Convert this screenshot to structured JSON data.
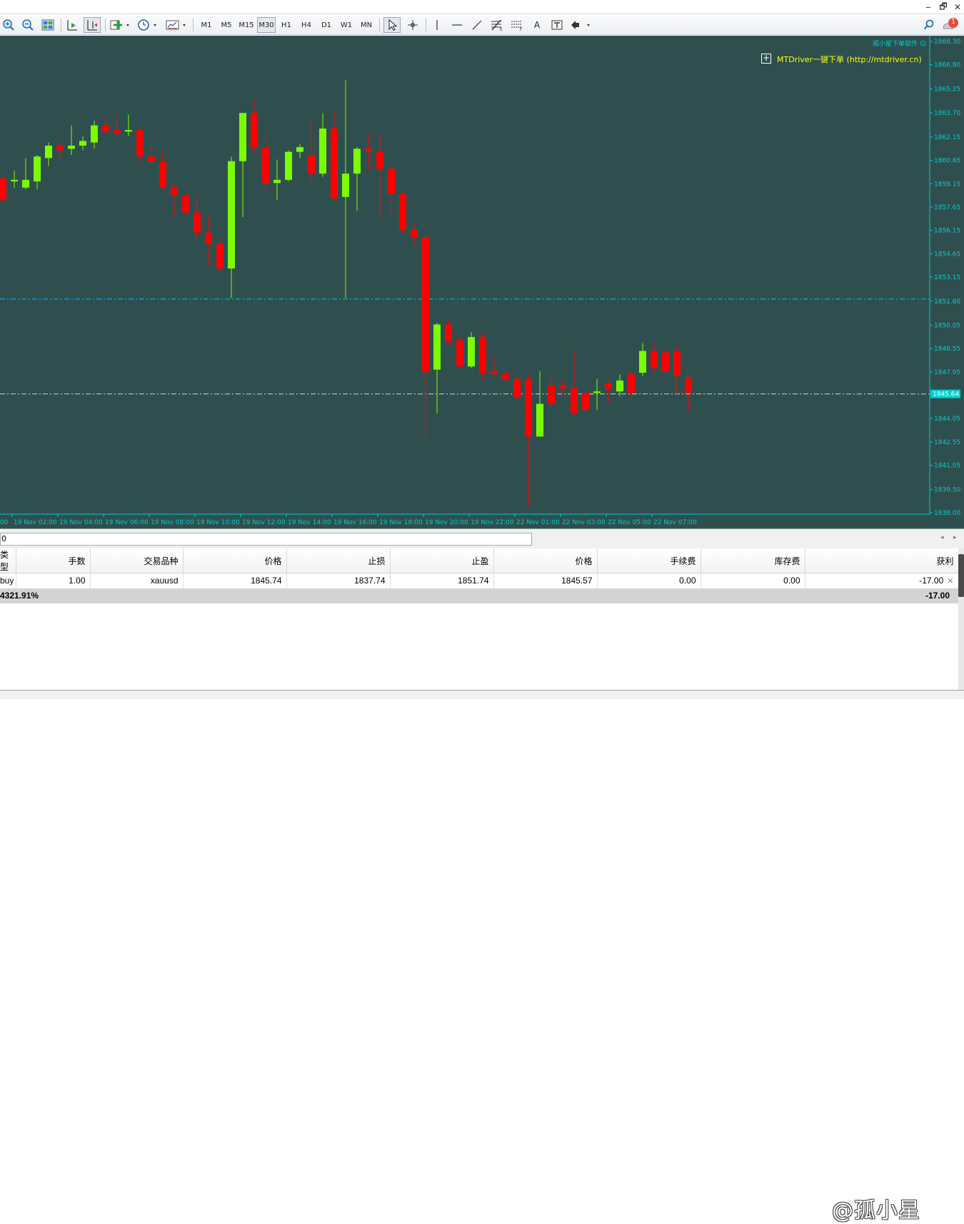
{
  "window": {
    "minimize": "‒",
    "restore": "🗗",
    "close": "✕"
  },
  "toolbar": {
    "timeframes": [
      {
        "label": "M1",
        "active": false
      },
      {
        "label": "M5",
        "active": false
      },
      {
        "label": "M15",
        "active": false
      },
      {
        "label": "M30",
        "active": true
      },
      {
        "label": "H1",
        "active": false
      },
      {
        "label": "H4",
        "active": false
      },
      {
        "label": "D1",
        "active": false
      },
      {
        "label": "W1",
        "active": false
      },
      {
        "label": "MN",
        "active": false
      }
    ],
    "icons": [
      "zoom-in-icon",
      "zoom-out-icon",
      "tile-windows-icon",
      "auto-scroll-icon",
      "chart-shift-icon",
      "indicators-icon",
      "clock-icon",
      "templates-icon",
      "cursor-icon",
      "crosshair-icon",
      "vertical-line-icon",
      "horizontal-line-icon",
      "trendline-icon",
      "fibonacci-icon",
      "channel-icon",
      "text-icon",
      "text-label-icon",
      "arrows-icon",
      "search-icon",
      "notifications-icon"
    ],
    "text_tool": "A",
    "notification_count": "1"
  },
  "chart": {
    "corner_label": "孤小星下单软件 ☺",
    "plugin_label": "MTDriver一键下单 (http://mtdriver.cn)",
    "plugin_button": "+",
    "bid_line": 1845.64,
    "bid_label": "1845.64",
    "tp_line": 1851.74,
    "colors": {
      "bg": "#2f4f4f",
      "bull": "#7cfc00",
      "bear": "#ff0000",
      "axis": "#00ced1",
      "bid_line": "#d3d3d3",
      "tp_line": "#00bfff"
    }
  },
  "chart_data": {
    "type": "candlestick",
    "symbol": "xauusd",
    "timeframe": "M30",
    "ylim": [
      1838.0,
      1868.3
    ],
    "y_ticks": [
      "1868.30",
      "1866.80",
      "1865.25",
      "1863.70",
      "1862.15",
      "1860.65",
      "1859.15",
      "1857.65",
      "1856.15",
      "1854.65",
      "1853.15",
      "1851.60",
      "1850.05",
      "1848.55",
      "1847.05",
      "1845.64",
      "1844.05",
      "1842.55",
      "1841.05",
      "1839.50",
      "1838.00"
    ],
    "x_ticks": [
      ":00",
      "19 Nov 02:00",
      "19 Nov 04:00",
      "19 Nov 06:00",
      "19 Nov 08:00",
      "19 Nov 10:00",
      "19 Nov 12:00",
      "19 Nov 14:00",
      "19 Nov 16:00",
      "19 Nov 18:00",
      "19 Nov 20:00",
      "19 Nov 22:00",
      "22 Nov 01:00",
      "22 Nov 03:00",
      "22 Nov 05:00",
      "22 Nov 07:00"
    ],
    "candles": [
      [
        1859.5,
        1859.6,
        1857.9,
        1858.1
      ],
      [
        1859.3,
        1860.0,
        1858.9,
        1859.4
      ],
      [
        1858.9,
        1860.8,
        1858.8,
        1859.4
      ],
      [
        1859.3,
        1861.0,
        1858.8,
        1860.9
      ],
      [
        1860.8,
        1861.8,
        1860.3,
        1861.6
      ],
      [
        1861.6,
        1861.8,
        1860.8,
        1861.3
      ],
      [
        1861.4,
        1862.9,
        1861.0,
        1861.6
      ],
      [
        1861.6,
        1862.2,
        1861.3,
        1861.9
      ],
      [
        1861.8,
        1863.2,
        1861.4,
        1862.9
      ],
      [
        1862.9,
        1863.6,
        1862.3,
        1862.5
      ],
      [
        1862.6,
        1863.6,
        1862.2,
        1862.4
      ],
      [
        1862.5,
        1863.6,
        1862.2,
        1862.6
      ],
      [
        1862.6,
        1862.7,
        1860.5,
        1860.9
      ],
      [
        1860.9,
        1861.6,
        1860.3,
        1860.6
      ],
      [
        1860.6,
        1861.3,
        1858.8,
        1858.9
      ],
      [
        1858.9,
        1859.2,
        1857.0,
        1858.4
      ],
      [
        1858.4,
        1858.6,
        1857.2,
        1857.3
      ],
      [
        1857.3,
        1858.3,
        1855.6,
        1856.0
      ],
      [
        1856.0,
        1857.1,
        1853.9,
        1855.3
      ],
      [
        1855.3,
        1855.7,
        1853.6,
        1853.7
      ],
      [
        1853.7,
        1860.9,
        1851.8,
        1860.6
      ],
      [
        1860.6,
        1862.4,
        1857.0,
        1863.7
      ],
      [
        1863.7,
        1864.6,
        1861.1,
        1861.5
      ],
      [
        1861.5,
        1862.3,
        1858.7,
        1859.2
      ],
      [
        1859.2,
        1860.7,
        1858.1,
        1859.4
      ],
      [
        1859.4,
        1861.3,
        1859.3,
        1861.2
      ],
      [
        1861.2,
        1861.7,
        1860.8,
        1861.5
      ],
      [
        1861.0,
        1863.5,
        1859.1,
        1859.8
      ],
      [
        1859.8,
        1863.7,
        1859.6,
        1862.7
      ],
      [
        1862.7,
        1863.8,
        1858.6,
        1858.2
      ],
      [
        1858.3,
        1865.8,
        1851.8,
        1859.8
      ],
      [
        1859.8,
        1861.5,
        1857.4,
        1861.4
      ],
      [
        1861.4,
        1862.4,
        1860.0,
        1861.2
      ],
      [
        1861.2,
        1862.4,
        1856.9,
        1860.1
      ],
      [
        1860.1,
        1860.3,
        1857.2,
        1858.5
      ],
      [
        1858.5,
        1858.6,
        1855.9,
        1856.2
      ],
      [
        1856.2,
        1856.6,
        1855.2,
        1855.7
      ],
      [
        1855.7,
        1855.9,
        1842.8,
        1847.1
      ],
      [
        1847.2,
        1850.2,
        1844.4,
        1850.1
      ],
      [
        1850.1,
        1850.4,
        1848.7,
        1849.0
      ],
      [
        1849.1,
        1849.3,
        1847.2,
        1847.4
      ],
      [
        1847.4,
        1849.6,
        1847.3,
        1849.3
      ],
      [
        1849.3,
        1849.6,
        1846.5,
        1847.0
      ],
      [
        1847.1,
        1848.0,
        1846.9,
        1846.9
      ],
      [
        1846.9,
        1847.2,
        1846.2,
        1846.6
      ],
      [
        1846.6,
        1846.8,
        1845.3,
        1845.4
      ],
      [
        1846.6,
        1847.0,
        1838.4,
        1842.9
      ],
      [
        1842.9,
        1847.1,
        1842.9,
        1845.0
      ],
      [
        1846.2,
        1846.8,
        1844.8,
        1845.0
      ],
      [
        1846.2,
        1846.6,
        1845.6,
        1846.0
      ],
      [
        1846.0,
        1848.4,
        1844.2,
        1844.4
      ],
      [
        1845.7,
        1845.8,
        1844.5,
        1844.6
      ],
      [
        1845.7,
        1846.6,
        1844.6,
        1845.8
      ],
      [
        1846.3,
        1846.5,
        1845.1,
        1845.9
      ],
      [
        1845.8,
        1846.9,
        1845.5,
        1846.5
      ],
      [
        1846.9,
        1847.1,
        1845.3,
        1845.7
      ],
      [
        1847.0,
        1848.9,
        1846.8,
        1848.4
      ],
      [
        1848.4,
        1849.0,
        1846.9,
        1847.3
      ],
      [
        1848.3,
        1848.5,
        1847.1,
        1847.1
      ],
      [
        1848.4,
        1848.7,
        1845.6,
        1846.8
      ],
      [
        1846.7,
        1845.6,
        1844.5,
        1845.7
      ]
    ]
  },
  "tabs": {
    "first": "0",
    "prev": "◂",
    "next": "▸"
  },
  "terminal": {
    "columns": [
      "类型",
      "手数",
      "交易品种",
      "价格",
      "止损",
      "止盈",
      "价格",
      "手续费",
      "库存费",
      "获利"
    ],
    "rows": [
      [
        "buy",
        "1.00",
        "xauusd",
        "1845.74",
        "1837.74",
        "1851.74",
        "1845.57",
        "0.00",
        "0.00",
        "-17.00"
      ]
    ],
    "row_close": "✕",
    "summary": {
      "label": "4321.91%",
      "profit": "-17.00"
    }
  },
  "watermark": "@孤小星"
}
